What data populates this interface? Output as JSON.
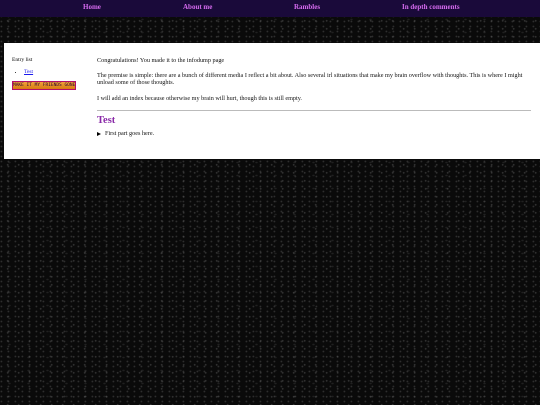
{
  "nav": {
    "items": [
      {
        "label": "Home"
      },
      {
        "label": "About me"
      },
      {
        "label": "Rambles"
      },
      {
        "label": "In depth comments"
      }
    ]
  },
  "sidebar": {
    "title": "Entry list",
    "entries": [
      {
        "label": "Test"
      }
    ],
    "badge_text": "MAKE IT MY FRIENDS GONE"
  },
  "main": {
    "intro": "Congratulations! You made it to the infodump page",
    "premise": "The premise is simple: there are a bunch of different media I reflect a bit about. Also several irl situations that make my brain overflow with thoughts. This is where I might unload some of those thoughts.",
    "index_note": "I will add an index because otherwise my brain will hurt, though this is still empty.",
    "section_title": "Test",
    "details_summary": "First part goes here."
  },
  "colors": {
    "nav_bg": "#1a0a3a",
    "nav_text": "#d66bf0",
    "heading": "#8a2aa8",
    "link": "#1a1aee"
  }
}
